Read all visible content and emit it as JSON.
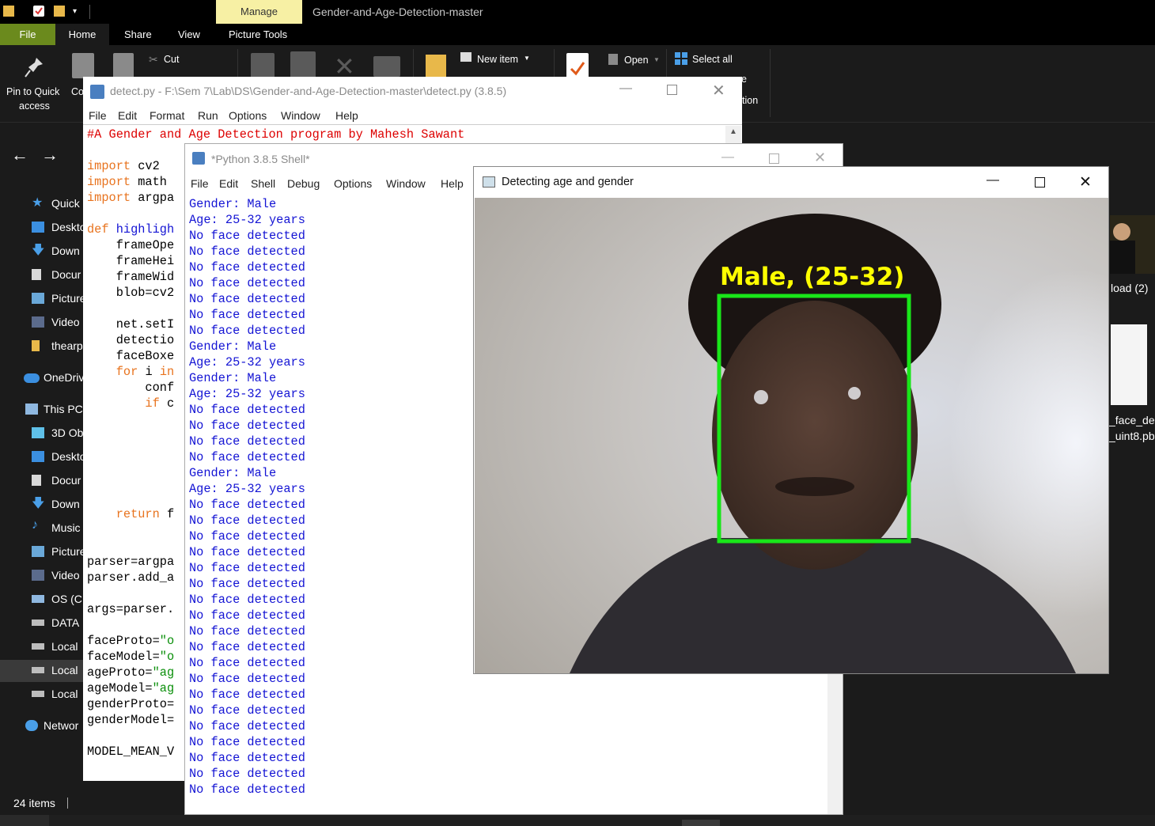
{
  "explorer": {
    "manage_tab": "Manage",
    "window_title": "Gender-and-Age-Detection-master",
    "tabs": [
      "File",
      "Home",
      "Share",
      "View",
      "Picture Tools"
    ],
    "ribbon": {
      "pin_line1": "Pin to Quick",
      "pin_line2": "access",
      "copy_partial": "Co",
      "cut": "Cut",
      "new_item": "New item",
      "open": "Open",
      "select_all": "Select all",
      "partial_e": "e",
      "partial_tion": "tion"
    },
    "sidebar": [
      {
        "label": "Quick a",
        "icon": "star-icon"
      },
      {
        "label": "Deskto",
        "icon": "desktop-icon"
      },
      {
        "label": "Down",
        "icon": "download-icon"
      },
      {
        "label": "Docur",
        "icon": "document-icon"
      },
      {
        "label": "Picture",
        "icon": "pictures-icon"
      },
      {
        "label": "Video",
        "icon": "video-icon"
      },
      {
        "label": "thearp",
        "icon": "folder-icon"
      },
      {
        "label": "OneDriv",
        "icon": "cloud-icon"
      },
      {
        "label": "This PC",
        "icon": "computer-icon"
      },
      {
        "label": "3D Ob",
        "icon": "cube-icon"
      },
      {
        "label": "Deskto",
        "icon": "desktop-icon"
      },
      {
        "label": "Docur",
        "icon": "document-icon"
      },
      {
        "label": "Down",
        "icon": "download-icon"
      },
      {
        "label": "Music",
        "icon": "music-icon"
      },
      {
        "label": "Picture",
        "icon": "pictures-icon"
      },
      {
        "label": "Video",
        "icon": "video-icon"
      },
      {
        "label": "OS (C:",
        "icon": "drive-icon"
      },
      {
        "label": "DATA",
        "icon": "drive-icon"
      },
      {
        "label": "Local",
        "icon": "drive-icon"
      },
      {
        "label": "Local",
        "icon": "drive-icon"
      },
      {
        "label": "Local",
        "icon": "drive-icon"
      },
      {
        "label": "Networ",
        "icon": "network-icon"
      }
    ],
    "right_files": {
      "file1": "load (2)",
      "file2_line1": "_face_de",
      "file2_line2": "_uint8.pb"
    },
    "status": "24 items"
  },
  "detect": {
    "title": "detect.py - F:\\Sem 7\\Lab\\DS\\Gender-and-Age-Detection-master\\detect.py (3.8.5)",
    "menu": [
      "File",
      "Edit",
      "Format",
      "Run",
      "Options",
      "Window",
      "Help"
    ],
    "code": {
      "l1": "#A Gender and Age Detection program by Mahesh Sawant",
      "l3k": "import",
      "l3": " cv2",
      "l4k": "import",
      "l4": " math",
      "l5k": "import",
      "l5": " argpa",
      "l7k": "def",
      "l7": " highligh",
      "l8": "    frameOpe",
      "l9": "    frameHei",
      "l10": "    frameWid",
      "l11": "    blob=cv2",
      "l13": "    net.setI",
      "l14": "    detectio",
      "l15": "    faceBoxe",
      "l16k": "    for",
      "l16a": " i ",
      "l16k2": "in",
      "l17": "        conf",
      "l18k": "        if",
      "l18": " c",
      "l23k": "    return",
      "l23": " f",
      "l26": "parser=argpa",
      "l27": "parser.add_a",
      "l29": "args=parser.",
      "l31a": "faceProto=",
      "l31s": "\"o",
      "l32a": "faceModel=",
      "l32s": "\"o",
      "l33a": "ageProto=",
      "l33s": "\"ag",
      "l34a": "ageModel=",
      "l34s": "\"ag",
      "l35": "genderProto=",
      "l36": "genderModel=",
      "l38": "MODEL_MEAN_V"
    }
  },
  "shell": {
    "title": "*Python 3.8.5 Shell*",
    "menu": [
      "File",
      "Edit",
      "Shell",
      "Debug",
      "Options",
      "Window",
      "Help"
    ],
    "output": [
      "Gender: Male",
      "Age: 25-32 years",
      "No face detected",
      "No face detected",
      "No face detected",
      "No face detected",
      "No face detected",
      "No face detected",
      "No face detected",
      "Gender: Male",
      "Age: 25-32 years",
      "Gender: Male",
      "Age: 25-32 years",
      "No face detected",
      "No face detected",
      "No face detected",
      "No face detected",
      "Gender: Male",
      "Age: 25-32 years",
      "No face detected",
      "No face detected",
      "No face detected",
      "No face detected",
      "No face detected",
      "No face detected",
      "No face detected",
      "No face detected",
      "No face detected",
      "No face detected",
      "No face detected",
      "No face detected",
      "No face detected",
      "No face detected",
      "No face detected",
      "No face detected",
      "No face detected",
      "No face detected",
      "No face detected"
    ]
  },
  "camera": {
    "title": "Detecting age and gender",
    "label": "Male, (25-32)",
    "box_color": "#19e619",
    "label_color": "#ffff00"
  }
}
